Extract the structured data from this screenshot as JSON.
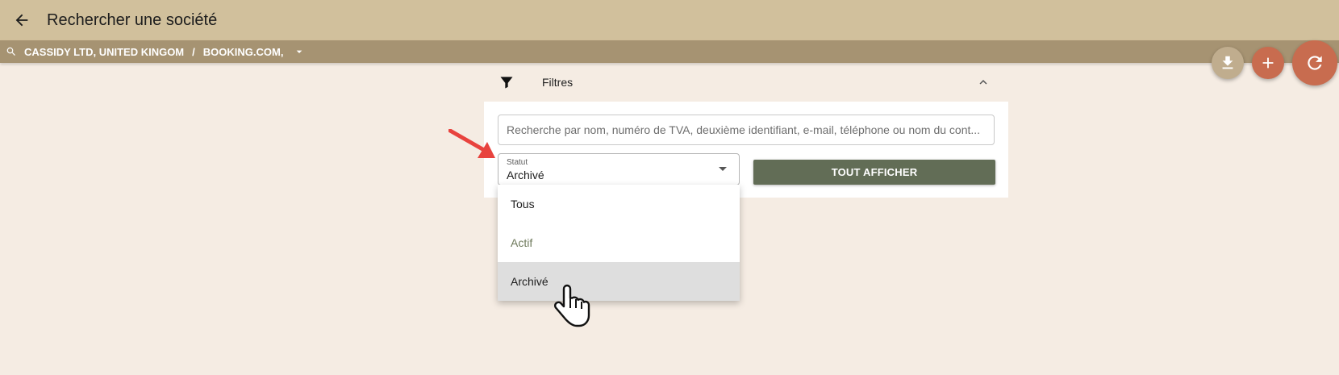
{
  "header": {
    "title": "Rechercher une société"
  },
  "breadcrumb": {
    "items": [
      "CASSIDY LTD, UNITED KINGOM",
      "BOOKING.COM,"
    ],
    "separator": "/"
  },
  "fabs": [
    {
      "name": "download",
      "icon": "download-icon"
    },
    {
      "name": "add",
      "icon": "plus-icon"
    },
    {
      "name": "refresh",
      "icon": "refresh-icon"
    }
  ],
  "filters": {
    "label": "Filtres",
    "search": {
      "value": "",
      "placeholder": "Recherche par nom, numéro de TVA, deuxième identifiant, e-mail, téléphone ou nom du cont..."
    },
    "status": {
      "label": "Statut",
      "value": "Archivé"
    },
    "show_all_label": "TOUT AFFICHER"
  },
  "status_options": [
    "Tous",
    "Actif",
    "Archivé"
  ],
  "colors": {
    "topbar": "#d1c09c",
    "subbar": "#a69372",
    "background": "#f5ece3",
    "accent": "#c86c4f",
    "button": "#626d56",
    "arrow": "#e8433e"
  }
}
